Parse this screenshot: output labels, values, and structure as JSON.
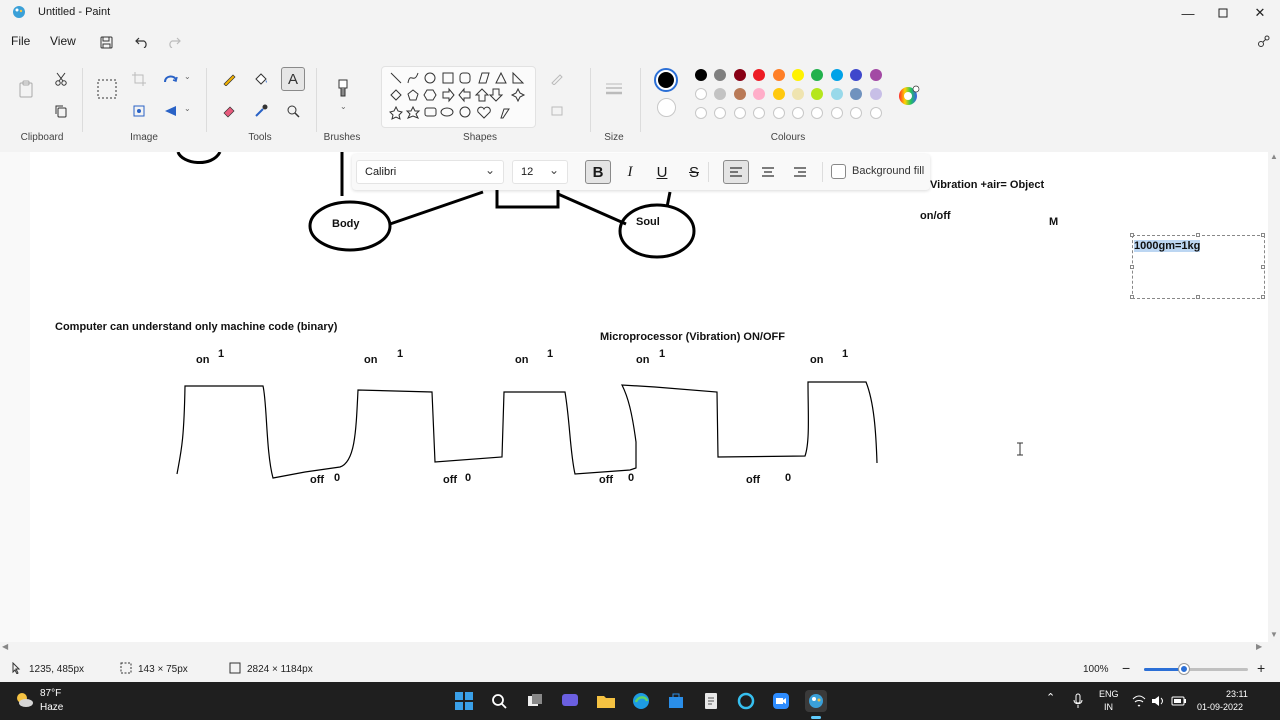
{
  "window": {
    "title": "Untitled - Paint"
  },
  "menu": {
    "file": "File",
    "view": "View"
  },
  "ribbon": {
    "groups": {
      "clipboard": "Clipboard",
      "image": "Image",
      "tools": "Tools",
      "brushes": "Brushes",
      "shapes": "Shapes",
      "size": "Size",
      "colours": "Colours"
    },
    "palette_row1": [
      "#000000",
      "#7f7f7f",
      "#880015",
      "#ed1c24",
      "#ff7f27",
      "#fff200",
      "#22b14c",
      "#00a2e8",
      "#3f48cc",
      "#a349a4"
    ],
    "palette_row2": [
      "#ffffff",
      "#c3c3c3",
      "#b97a57",
      "#ffaec9",
      "#ffc90e",
      "#efe4b0",
      "#b5e61d",
      "#99d9ea",
      "#7092be",
      "#c8bfe7"
    ],
    "primary_color": "#000000",
    "secondary_color": "#ffffff"
  },
  "textbar": {
    "font": "Calibri",
    "size": "12",
    "bold": "B",
    "italic": "I",
    "underline": "U",
    "strike": "S",
    "background_fill": "Background fill"
  },
  "canvas": {
    "body": "Body",
    "soul": "Soul",
    "vibration": "Vibration +air= Object",
    "onoff": "on/off",
    "m": "M",
    "kg": "1000gm=1kg",
    "computer": "Computer can understand only machine code (binary)",
    "micro": "Microprocessor (Vibration) ON/OFF",
    "on": "on",
    "off": "off",
    "one": "1",
    "zero": "0"
  },
  "status": {
    "cursor": "1235, 485px",
    "selection": "143 × 75px",
    "canvas_size": "2824 × 1184px",
    "zoom": "100%"
  },
  "taskbar": {
    "temp": "87°F",
    "weather": "Haze",
    "lang1": "ENG",
    "lang2": "IN",
    "time": "23:11",
    "date": "01-09-2022"
  }
}
